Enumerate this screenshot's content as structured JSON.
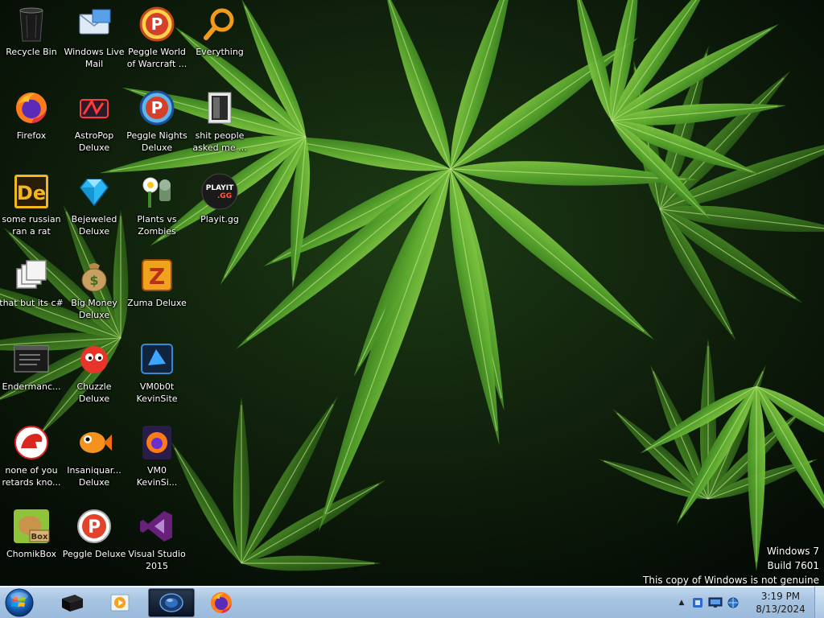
{
  "desktop": {
    "icons": [
      {
        "label": "Recycle Bin",
        "icon": "recycle-bin-icon"
      },
      {
        "label": "Windows Live\nMail",
        "icon": "mail-icon"
      },
      {
        "label": "Peggle World\nof Warcraft ...",
        "icon": "peggle-icon"
      },
      {
        "label": "Everything",
        "icon": "search-icon"
      },
      {
        "label": "Firefox",
        "icon": "firefox-icon"
      },
      {
        "label": "AstroPop\nDeluxe",
        "icon": "astropop-icon"
      },
      {
        "label": "Peggle Nights\nDeluxe",
        "icon": "peggle-nights-icon"
      },
      {
        "label": "shit people\nasked me ...",
        "icon": "folder-icon"
      },
      {
        "label": "some russian\nran a rat",
        "icon": "de-icon"
      },
      {
        "label": "Bejeweled\nDeluxe",
        "icon": "gem-icon"
      },
      {
        "label": "Plants vs\nZombies",
        "icon": "plants-icon"
      },
      {
        "label": "Playit.gg",
        "icon": "playit-icon"
      },
      {
        "label": "that but its c#",
        "icon": "windows-stack-icon"
      },
      {
        "label": "Big Money\nDeluxe",
        "icon": "money-bag-icon"
      },
      {
        "label": "Zuma Deluxe",
        "icon": "zuma-icon"
      },
      {
        "label": "Endermanc...",
        "icon": "console-icon"
      },
      {
        "label": "Chuzzle\nDeluxe",
        "icon": "chuzzle-icon"
      },
      {
        "label": "VM0b0t\nKevinSite",
        "icon": "vm-icon"
      },
      {
        "label": "none of you\nretards kno...",
        "icon": "red-dino-icon"
      },
      {
        "label": "Insaniquar...\nDeluxe",
        "icon": "fish-icon"
      },
      {
        "label": "VM0\nKevinSi...",
        "icon": "firefox-purple-icon"
      },
      {
        "label": "ChomikBox",
        "icon": "hamster-icon"
      },
      {
        "label": "Peggle Deluxe",
        "icon": "peggle-deluxe-icon"
      },
      {
        "label": "Visual Studio\n2015",
        "icon": "visual-studio-icon"
      }
    ]
  },
  "watermark": {
    "line1": "Windows 7",
    "line2": "Build 7601",
    "line3": "This copy of Windows is not genuine"
  },
  "taskbar": {
    "start_icon": "windows-orb-icon",
    "pinned": [
      {
        "icon": "black-box-icon",
        "active": false
      },
      {
        "icon": "media-player-icon",
        "active": false
      },
      {
        "icon": "vm-app-icon",
        "active": true
      },
      {
        "icon": "firefox-icon",
        "active": false
      }
    ],
    "tray": {
      "show_hidden": "▲",
      "time": "3:19 PM",
      "date": "8/13/2024"
    }
  },
  "colors": {
    "taskbar_top": "#c2d8ee",
    "taskbar_bottom": "#9bbadb",
    "leaf_green": "#4f9a2a",
    "leaf_light": "#7cc23e",
    "background_dark": "#07130a"
  }
}
